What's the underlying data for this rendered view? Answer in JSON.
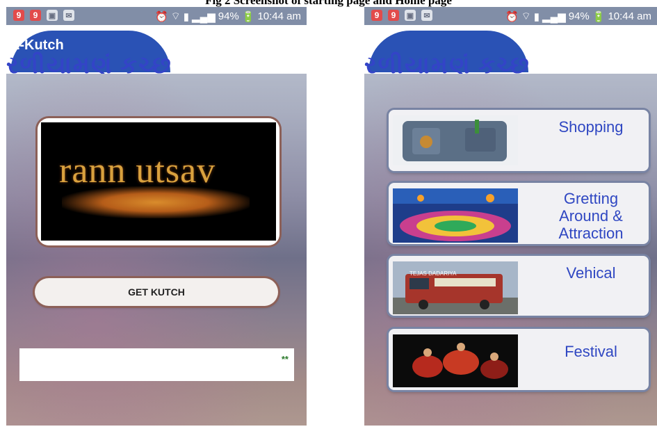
{
  "caption": "Fig 2 Screenshot of starting page and Home page",
  "status_bar": {
    "left_icons": [
      "notification-icon",
      "notification-icon",
      "gallery-icon",
      "message-icon"
    ],
    "battery": "94%",
    "time": "10:44 am"
  },
  "banner": {
    "app_name": "E-Kutch",
    "gujarati_title": "રળીયામણું કચ્છ"
  },
  "start_page": {
    "image_text": "rann utsav",
    "button_label": "GET KUTCH",
    "ad_marker": "**"
  },
  "home_page": {
    "menu": [
      {
        "label": "Shopping"
      },
      {
        "label": "Gretting Around & Attraction"
      },
      {
        "label": "Vehical"
      },
      {
        "label": "Festival"
      }
    ],
    "bus_text": "TEJAS DADARIYA"
  },
  "colors": {
    "menu_text": "#2f47c2",
    "card_border": "#7883a3",
    "button_border": "#8c6058",
    "banner_blue": "#2a52b5"
  }
}
